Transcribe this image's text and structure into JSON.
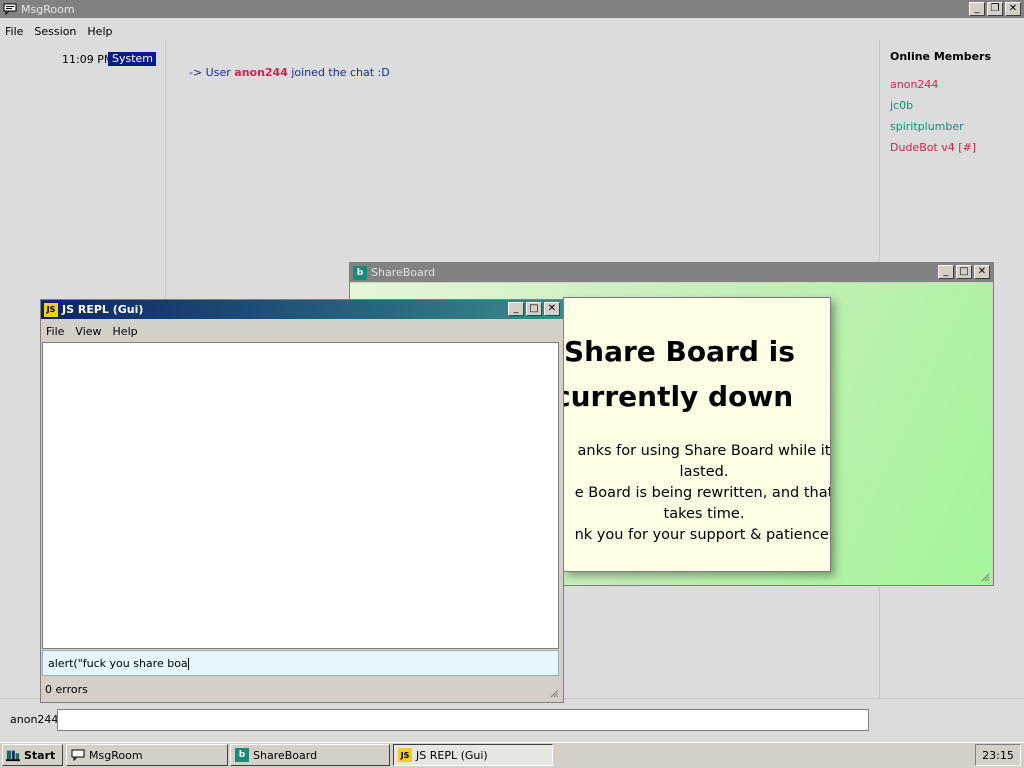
{
  "msgroom": {
    "title": "MsgRoom",
    "menu": [
      "File",
      "Session",
      "Help"
    ],
    "messages": [
      {
        "time": "11:09 PM",
        "sender": "System",
        "prefix": "-> User ",
        "user": "anon244",
        "suffix": " joined the chat :D"
      }
    ],
    "members_heading": "Online Members",
    "members": [
      {
        "name": "anon244",
        "color": "#d4224e"
      },
      {
        "name": "jc0b",
        "color": "#1a8a7a"
      },
      {
        "name": "spiritplumber",
        "color": "#1a8a7a"
      },
      {
        "name": "DudeBot v4 [#]",
        "color": "#d4224e"
      }
    ],
    "nickname": "anon244",
    "message_input_value": ""
  },
  "shareboard": {
    "title": "ShareBoard",
    "headline_1": "Share Board is",
    "headline_2": "currently down",
    "lines": [
      "anks for using Share Board while it",
      "lasted.",
      "e Board is being rewritten, and that",
      "takes time.",
      "nk you for your support & patience."
    ]
  },
  "repl": {
    "title": "JS REPL (Gui)",
    "icon_text": "JS",
    "menu": [
      "File",
      "View",
      "Help"
    ],
    "input_value": "alert(\"fuck you share boa",
    "status": "0 errors"
  },
  "taskbar": {
    "start_label": "Start",
    "buttons": [
      "MsgRoom",
      "ShareBoard",
      "JS REPL (Gui)"
    ],
    "active_index": 2,
    "clock": "23:15"
  },
  "colors": {
    "titlebar_inactive": "#828282",
    "titlebar_active_start": "#0a246a",
    "titlebar_active_end": "#3a8a8a",
    "system_badge": "#0a1a8a",
    "message_text": "#1a2a9a",
    "user_highlight": "#d4224e"
  }
}
